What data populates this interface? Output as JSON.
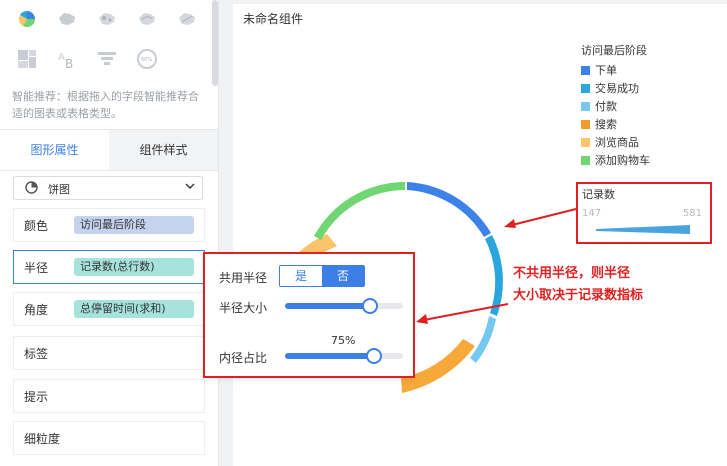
{
  "sidebar": {
    "chart_icons": [
      {
        "name": "pie-chart-icon",
        "active": true
      },
      {
        "name": "china-map-icon",
        "active": false
      },
      {
        "name": "scatter-map-icon",
        "active": false
      },
      {
        "name": "flow-map-icon",
        "active": false
      },
      {
        "name": "heat-map-icon",
        "active": false
      },
      {
        "name": "treemap-icon",
        "active": false
      },
      {
        "name": "text-chart-icon",
        "active": false
      },
      {
        "name": "funnel-icon",
        "active": false
      },
      {
        "name": "gauge-icon",
        "active": false
      }
    ],
    "hint": "智能推荐：根据拖入的字段智能推荐合适的图表或表格类型。",
    "tabs": {
      "active": "图形属性",
      "other": "组件样式"
    },
    "chart_type": "饼图",
    "rows": {
      "color": {
        "label": "颜色",
        "field": "访问最后阶段"
      },
      "radius": {
        "label": "半径",
        "field": "记录数(总行数)"
      },
      "angle": {
        "label": "角度",
        "field": "总停留时间(求和)"
      },
      "label": {
        "label": "标签"
      },
      "tooltip": {
        "label": "提示"
      },
      "granularity": {
        "label": "细粒度"
      }
    }
  },
  "popup": {
    "shared_radius_label": "共用半径",
    "yes_label": "是",
    "no_label": "否",
    "radius_size_label": "半径大小",
    "inner_ratio_label": "内径占比",
    "inner_ratio_value": "75%",
    "radius_size_level": 0.72,
    "inner_ratio_level": 0.75
  },
  "canvas": {
    "component_title": "未命名组件",
    "legend_title": "访问最后阶段",
    "legend": [
      {
        "label": "下单",
        "color": "#3d82e8"
      },
      {
        "label": "交易成功",
        "color": "#29a6de"
      },
      {
        "label": "付款",
        "color": "#74c8f2"
      },
      {
        "label": "搜索",
        "color": "#f29b2b"
      },
      {
        "label": "浏览商品",
        "color": "#f9c46a"
      },
      {
        "label": "添加购物车",
        "color": "#6fd672"
      }
    ],
    "size_legend": {
      "title": "记录数",
      "min": "147",
      "max": "581"
    },
    "annotation_line1": "不共用半径，则半径",
    "annotation_line2": "大小取决于记录数指标"
  },
  "colors": {
    "accent": "#3d7fe6",
    "highlight": "#e02020"
  }
}
